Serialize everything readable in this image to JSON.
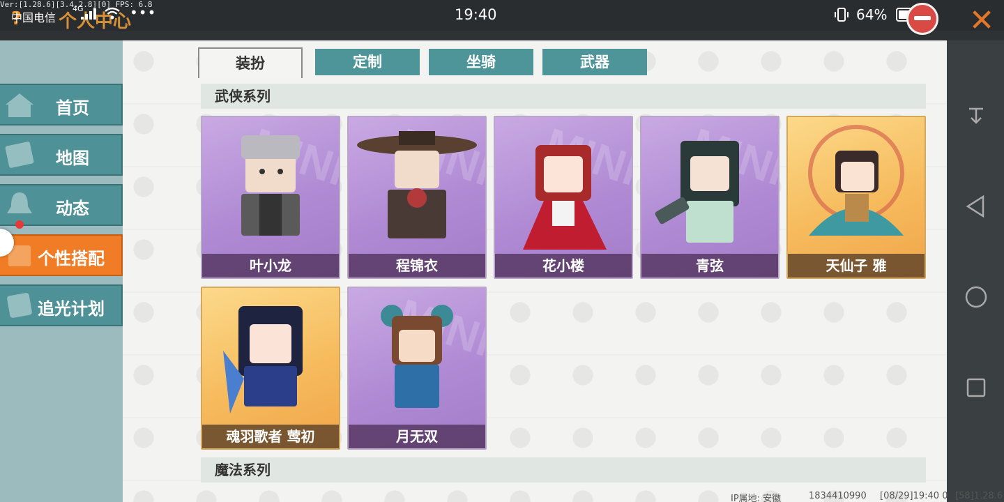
{
  "status_bar": {
    "version": "Ver:[1.28.6][3.4.2.8][0] FPS: 6.8",
    "carrier": "中国电信",
    "network": "4G",
    "overflow_dots": "•••",
    "time": "19:40",
    "battery": "64%",
    "title_ghost": "个人中心",
    "help_icon": "?"
  },
  "window": {
    "close": "✕"
  },
  "sidebar": {
    "items": [
      {
        "label": "首页",
        "icon": "home-icon"
      },
      {
        "label": "地图",
        "icon": "map-icon"
      },
      {
        "label": "动态",
        "icon": "bell-icon"
      },
      {
        "label": "个性搭配",
        "icon": "wardrobe-icon",
        "active": true
      },
      {
        "label": "追光计划",
        "icon": "plan-icon"
      }
    ]
  },
  "tabs": [
    {
      "label": "装扮",
      "active": true
    },
    {
      "label": "定制"
    },
    {
      "label": "坐骑"
    },
    {
      "label": "武器"
    }
  ],
  "sections": [
    {
      "title": "武侠系列",
      "cards": [
        {
          "name": "叶小龙",
          "tier": "purple"
        },
        {
          "name": "程锦衣",
          "tier": "purple"
        },
        {
          "name": "花小楼",
          "tier": "purple"
        },
        {
          "name": "青弦",
          "tier": "purple"
        },
        {
          "name": "天仙子 雅",
          "tier": "gold"
        },
        {
          "name": "魂羽歌者 莺初",
          "tier": "gold"
        },
        {
          "name": "月无双",
          "tier": "purple"
        }
      ]
    },
    {
      "title": "魔法系列",
      "cards": []
    }
  ],
  "footer": {
    "ip": "IP属地: 安徽",
    "uid": "1834410990",
    "timestamp": "[08/29]19:40 0",
    "build": "[58]1.28.6"
  },
  "colors": {
    "accent": "#f07d26",
    "teal": "#4e9196",
    "purple_card": "#b08bd4",
    "gold_card": "#f6bb5d"
  }
}
